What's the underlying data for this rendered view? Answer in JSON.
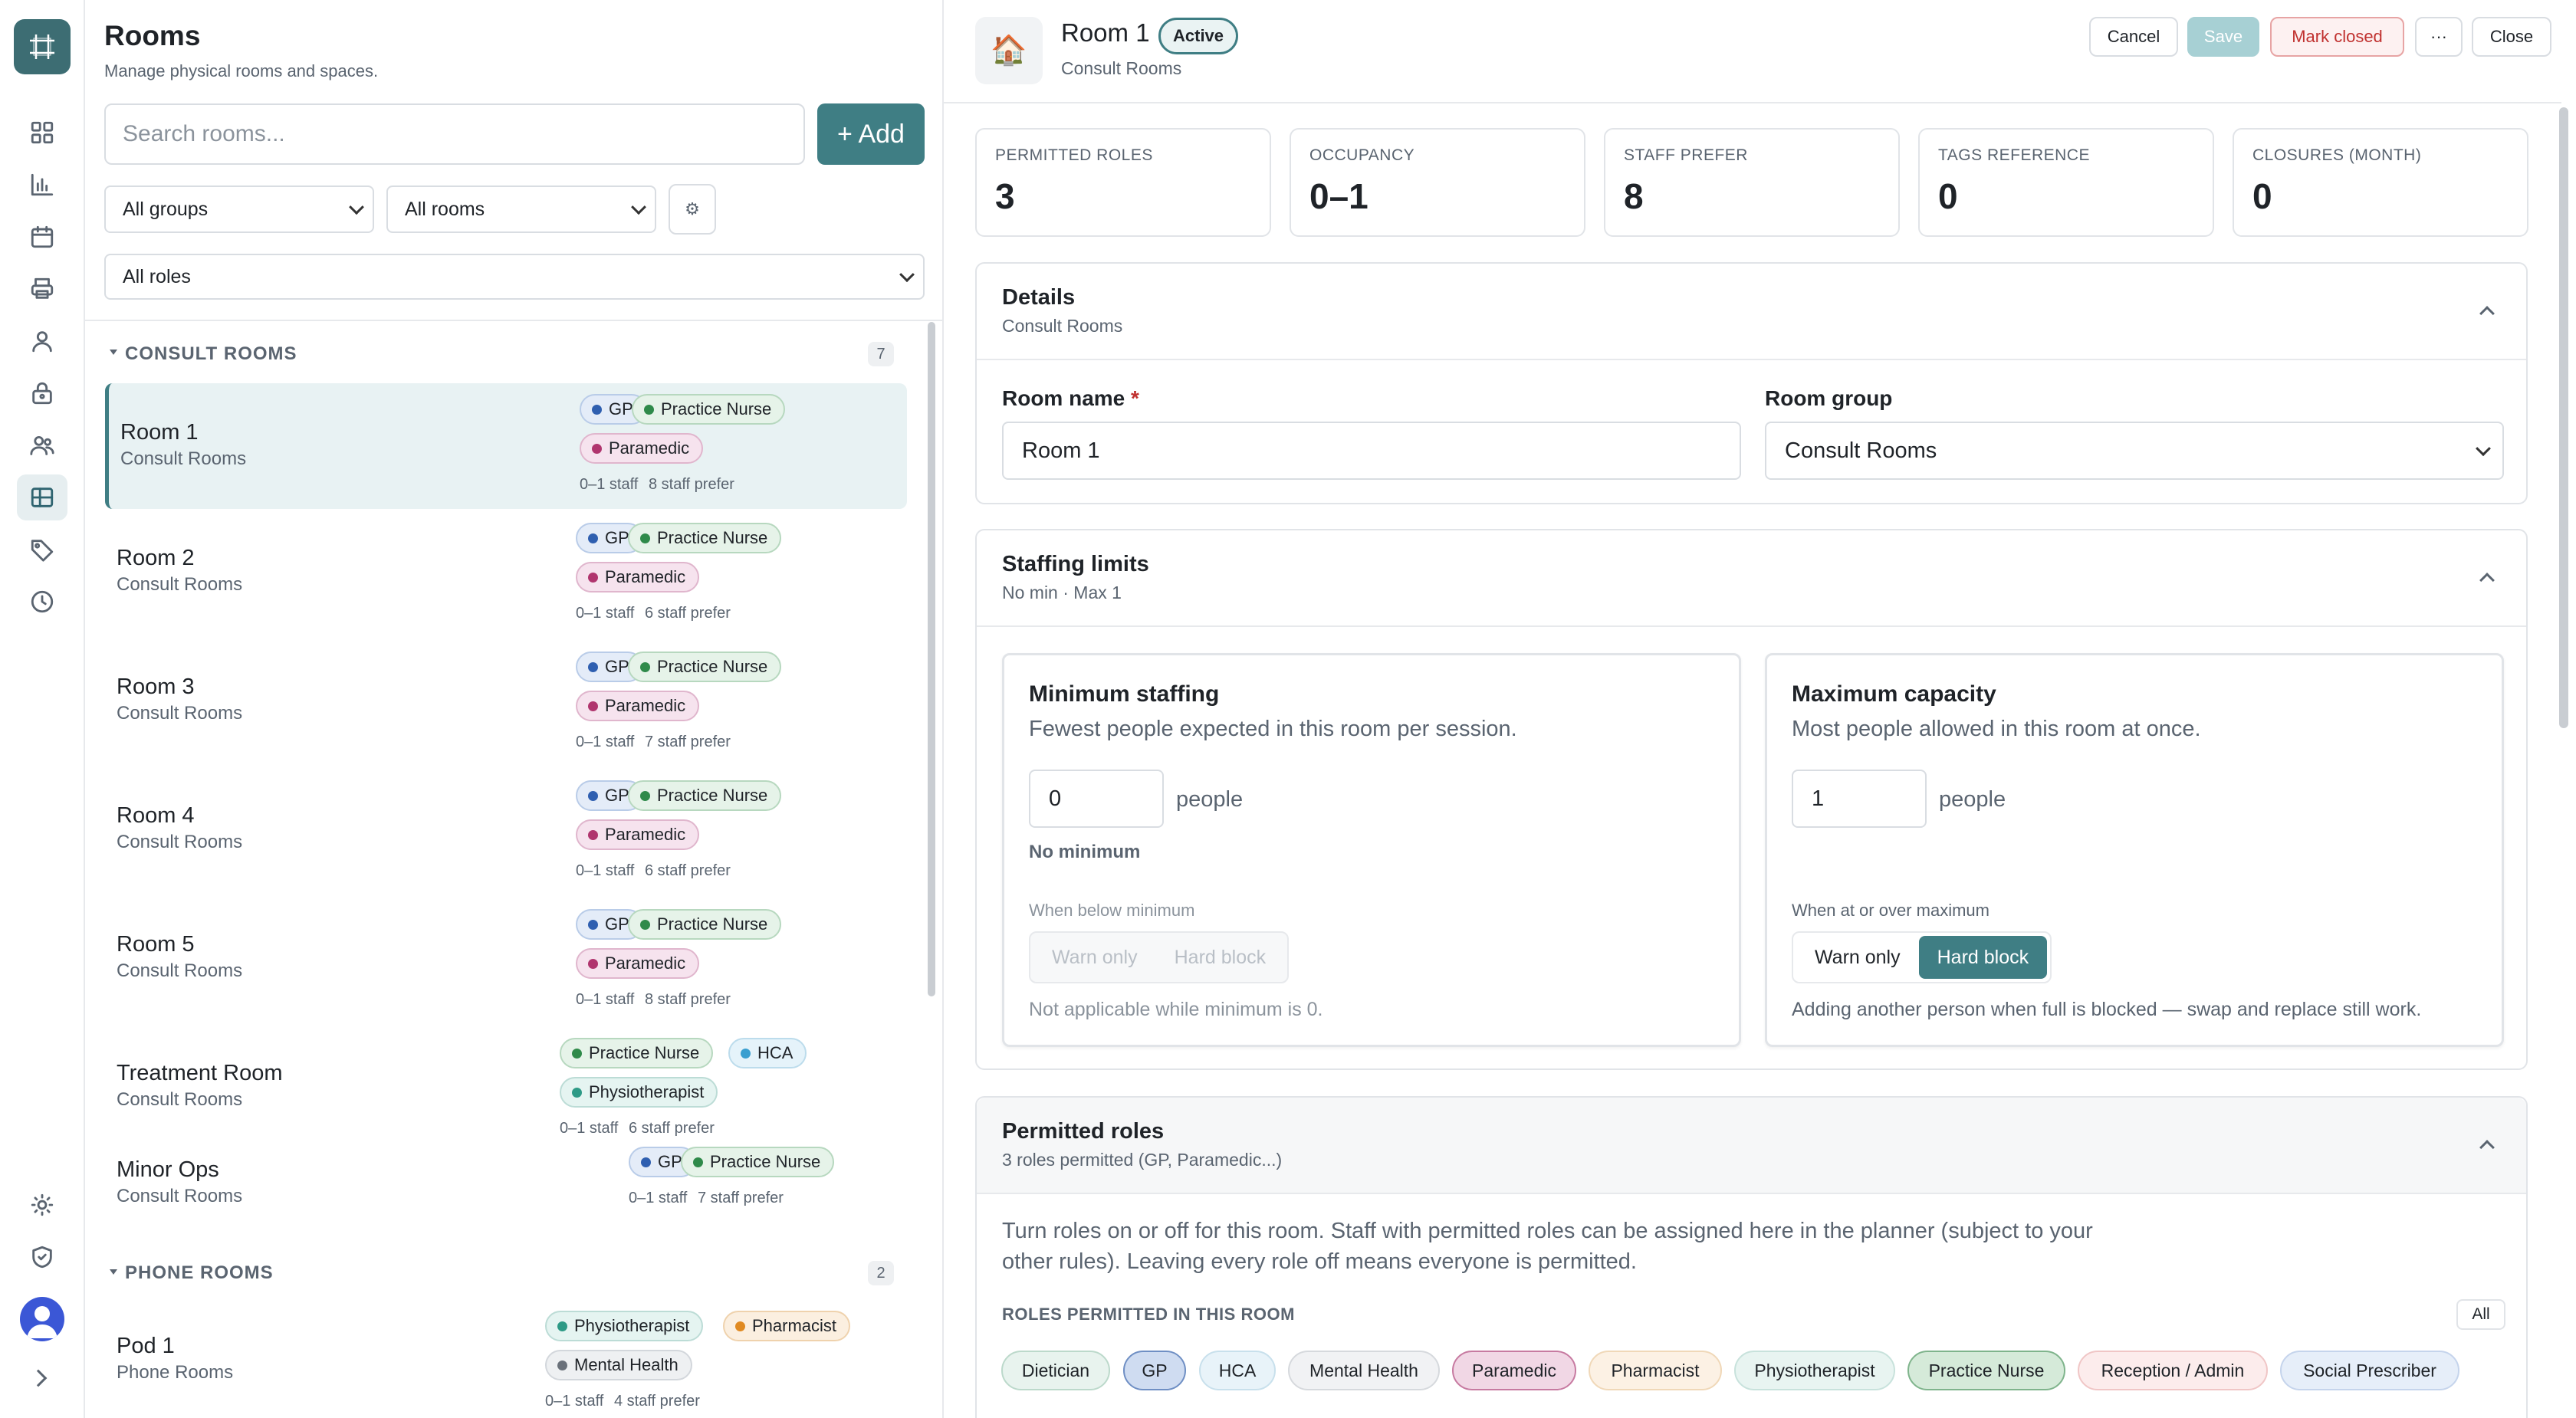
{
  "rail": {
    "icons": [
      "grid-icon",
      "chart-icon",
      "calendar-icon",
      "printer-icon",
      "user-icon",
      "lock-icon",
      "users-icon",
      "rooms-icon",
      "tag-icon",
      "clock-icon",
      "sun-icon",
      "shield-icon"
    ],
    "active": "rooms-icon"
  },
  "list": {
    "title": "Rooms",
    "subtitle": "Manage physical rooms and spaces.",
    "search_placeholder": "Search rooms...",
    "add_label": "+ Add",
    "filter_groups": "All groups",
    "filter_rooms": "All rooms",
    "filter_roles": "All roles",
    "groups": [
      {
        "name": "CONSULT ROOMS",
        "count": "7",
        "rooms": [
          {
            "name": "Room 1",
            "group": "Consult Rooms",
            "roles": [
              "GP",
              "Practice Nurse",
              "Paramedic"
            ],
            "staff": "0–1 staff",
            "prefer": "8 staff prefer"
          },
          {
            "name": "Room 2",
            "group": "Consult Rooms",
            "roles": [
              "GP",
              "Practice Nurse",
              "Paramedic"
            ],
            "staff": "0–1 staff",
            "prefer": "6 staff prefer"
          },
          {
            "name": "Room 3",
            "group": "Consult Rooms",
            "roles": [
              "GP",
              "Practice Nurse",
              "Paramedic"
            ],
            "staff": "0–1 staff",
            "prefer": "7 staff prefer"
          },
          {
            "name": "Room 4",
            "group": "Consult Rooms",
            "roles": [
              "GP",
              "Practice Nurse",
              "Paramedic"
            ],
            "staff": "0–1 staff",
            "prefer": "6 staff prefer"
          },
          {
            "name": "Room 5",
            "group": "Consult Rooms",
            "roles": [
              "GP",
              "Practice Nurse",
              "Paramedic"
            ],
            "staff": "0–1 staff",
            "prefer": "8 staff prefer"
          },
          {
            "name": "Treatment Room",
            "group": "Consult Rooms",
            "roles": [
              "Practice Nurse",
              "HCA",
              "Physiotherapist"
            ],
            "staff": "0–1 staff",
            "prefer": "6 staff prefer"
          },
          {
            "name": "Minor Ops",
            "group": "Consult Rooms",
            "roles": [
              "GP",
              "Practice Nurse"
            ],
            "staff": "0–1 staff",
            "prefer": "7 staff prefer"
          }
        ]
      },
      {
        "name": "PHONE ROOMS",
        "count": "2",
        "rooms": [
          {
            "name": "Pod 1",
            "group": "Phone Rooms",
            "roles": [
              "Physiotherapist",
              "Pharmacist",
              "Mental Health"
            ],
            "staff": "0–1 staff",
            "prefer": "4 staff prefer"
          }
        ]
      }
    ]
  },
  "detail": {
    "title": "Room 1",
    "status": "Active",
    "group": "Consult Rooms",
    "buttons": {
      "cancel": "Cancel",
      "save": "Save",
      "mark_closed": "Mark closed",
      "more": "···",
      "close": "Close"
    },
    "stats": [
      {
        "label": "PERMITTED ROLES",
        "value": "3"
      },
      {
        "label": "OCCUPANCY",
        "value": "0–1"
      },
      {
        "label": "STAFF PREFER",
        "value": "8"
      },
      {
        "label": "TAGS REFERENCE",
        "value": "0"
      },
      {
        "label": "CLOSURES (MONTH)",
        "value": "0"
      }
    ],
    "details": {
      "title": "Details",
      "subtitle": "Consult Rooms",
      "room_name_label": "Room name",
      "required_mark": "*",
      "room_name_value": "Room 1",
      "room_group_label": "Room group",
      "room_group_value": "Consult Rooms"
    },
    "staffing": {
      "title": "Staffing limits",
      "subtitle": "No min · Max 1",
      "min": {
        "title": "Minimum staffing",
        "desc": "Fewest people expected in this room per session.",
        "value": "0",
        "unit": "people",
        "status": "No minimum",
        "rule_label": "When below minimum",
        "opt1": "Warn only",
        "opt2": "Hard block",
        "note": "Not applicable while minimum is 0."
      },
      "max": {
        "title": "Maximum capacity",
        "desc": "Most people allowed in this room at once.",
        "value": "1",
        "unit": "people",
        "rule_label": "When at or over maximum",
        "opt1": "Warn only",
        "opt2": "Hard block",
        "selected": "Hard block",
        "note": "Adding another person when full is blocked — swap and replace still work."
      }
    },
    "roles": {
      "title": "Permitted roles",
      "subtitle": "3 roles permitted (GP, Paramedic...)",
      "desc_line1": "Turn roles on or off for this room. Staff with permitted roles can be assigned here in the planner (subject to your",
      "desc_line2": "other rules). Leaving every role off means everyone is permitted.",
      "section_label": "ROLES PERMITTED IN THIS ROOM",
      "all_label": "All",
      "chips": [
        {
          "label": "Dietician",
          "on": false
        },
        {
          "label": "GP",
          "on": true
        },
        {
          "label": "HCA",
          "on": false
        },
        {
          "label": "Mental Health",
          "on": false
        },
        {
          "label": "Paramedic",
          "on": true
        },
        {
          "label": "Pharmacist",
          "on": false
        },
        {
          "label": "Physiotherapist",
          "on": false
        },
        {
          "label": "Practice Nurse",
          "on": true
        },
        {
          "label": "Reception / Admin",
          "on": false
        },
        {
          "label": "Social Prescriber",
          "on": false
        }
      ]
    }
  },
  "colors": {
    "accent": "#3f7e84",
    "danger": "#c0312f",
    "selected_row": "#e8f2f3"
  }
}
